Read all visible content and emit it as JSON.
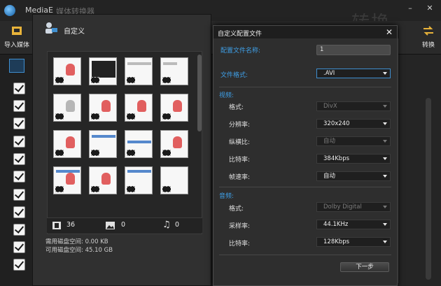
{
  "app": {
    "name": "MediaE",
    "name_dim": "媒体转换器",
    "big_text": "转换"
  },
  "toolbar": {
    "import_label": "导入媒体",
    "convert_label": "转换"
  },
  "custom_panel": {
    "title": "自定义",
    "video_count": "36",
    "image_count": "0",
    "music_count": "0",
    "disk_required": "需用磁盘空间:  0.00 KB",
    "disk_available": "可用磁盘空间:  45.10 GB"
  },
  "dialog": {
    "title": "自定义配置文件",
    "profile_name_label": "配置文件名称:",
    "profile_name_value": "1",
    "file_format_label": "文件格式:",
    "file_format_value": ".AVI",
    "video_section": "视频:",
    "video": {
      "format_label": "格式:",
      "format_value": "DivX",
      "resolution_label": "分辨率:",
      "resolution_value": "320x240",
      "aspect_label": "纵横比:",
      "aspect_value": "自动",
      "bitrate_label": "比特率:",
      "bitrate_value": "384Kbps",
      "framerate_label": "帧速率:",
      "framerate_value": "自动"
    },
    "audio_section": "音频:",
    "audio": {
      "format_label": "格式:",
      "format_value": "Dolby Digital",
      "samplerate_label": "采样率:",
      "samplerate_value": "44.1KHz",
      "bitrate_label": "比特率:",
      "bitrate_value": "128Kbps"
    },
    "next_button": "下一步"
  },
  "colors": {
    "accent": "#3fa0e8",
    "background": "#1c1c1c"
  },
  "icons": [
    "import-icon",
    "convert-icon",
    "profile-icon",
    "close-icon",
    "film-icon",
    "image-icon",
    "music-icon",
    "checkbox-icon"
  ]
}
